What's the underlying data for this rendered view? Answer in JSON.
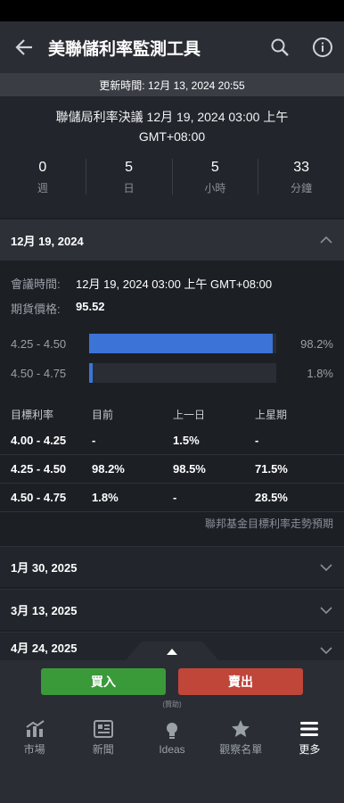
{
  "header": {
    "title": "美聯儲利率監測工具"
  },
  "updated": "更新時間: 12月 13, 2024 20:55",
  "countdown": {
    "title": "聯儲局利率決議 12月 19, 2024 03:00 上午 GMT+08:00",
    "cells": [
      {
        "value": "0",
        "unit": "週"
      },
      {
        "value": "5",
        "unit": "日"
      },
      {
        "value": "5",
        "unit": "小時"
      },
      {
        "value": "33",
        "unit": "分鐘"
      }
    ]
  },
  "open_meeting": {
    "date": "12月 19, 2024",
    "meeting_time_label": "會議時間:",
    "meeting_time": "12月 19, 2024 03:00 上午 GMT+08:00",
    "futures_label": "期貨價格:",
    "futures_price": "95.52",
    "bars": [
      {
        "range": "4.25 - 4.50",
        "pct": "98.2%",
        "value": 98.2
      },
      {
        "range": "4.50 - 4.75",
        "pct": "1.8%",
        "value": 1.8
      }
    ],
    "table": {
      "headers": [
        "目標利率",
        "目前",
        "上一日",
        "上星期"
      ],
      "rows": [
        [
          "4.00 - 4.25",
          "-",
          "1.5%",
          "-"
        ],
        [
          "4.25 - 4.50",
          "98.2%",
          "98.5%",
          "71.5%"
        ],
        [
          "4.50 - 4.75",
          "1.8%",
          "-",
          "28.5%"
        ]
      ]
    },
    "footnote": "聯邦基金目標利率走勢預期"
  },
  "meetings": [
    "1月 30, 2025",
    "3月 13, 2025",
    "4月 24, 2025"
  ],
  "actions": {
    "buy": "買入",
    "sell": "賣出",
    "sponsored": "(贊助)"
  },
  "tabs": [
    {
      "label": "市場",
      "icon": "chart-icon"
    },
    {
      "label": "新聞",
      "icon": "news-icon"
    },
    {
      "label": "Ideas",
      "icon": "bulb-icon"
    },
    {
      "label": "觀察名單",
      "icon": "star-icon"
    },
    {
      "label": "更多",
      "icon": "menu-icon",
      "active": true
    }
  ],
  "colors": {
    "accent": "#3b74d6",
    "buy": "#3a9a3a",
    "sell": "#c0463a"
  }
}
